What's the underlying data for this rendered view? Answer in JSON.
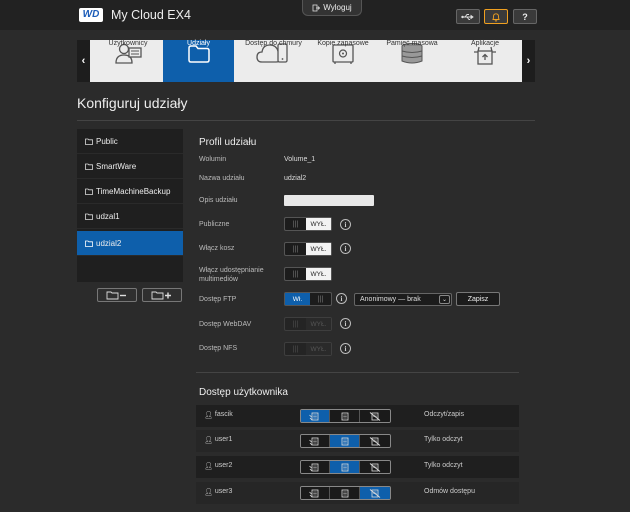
{
  "header": {
    "logo_text": "WD",
    "product": "My Cloud EX4",
    "logout_label": "Wyloguj",
    "help_label": "?"
  },
  "nav": {
    "items": [
      {
        "label": "Użytkownicy",
        "icon": "users-icon"
      },
      {
        "label": "Udziały",
        "icon": "folder-icon",
        "active": true
      },
      {
        "label": "Dostęp do chmury",
        "icon": "cloud-device-icon"
      },
      {
        "label": "Kopie zapasowe",
        "icon": "safe-icon"
      },
      {
        "label": "Pamięć masowa",
        "icon": "storage-stack-icon"
      },
      {
        "label": "Aplikacje",
        "icon": "apps-icon"
      }
    ]
  },
  "page_title": "Konfiguruj udziały",
  "shares": [
    {
      "name": "Public"
    },
    {
      "name": "SmartWare"
    },
    {
      "name": "TimeMachineBackup"
    },
    {
      "name": "udzal1"
    },
    {
      "name": "udzial2",
      "active": true
    }
  ],
  "profile": {
    "title": "Profil udziału",
    "volume_label": "Wolumin",
    "volume_value": "Volume_1",
    "share_name_label": "Nazwa udziału",
    "share_name_value": "udzial2",
    "desc_label": "Opis udziału",
    "desc_value": "",
    "public_label": "Publiczne",
    "public_state": "WYŁ.",
    "recycle_label": "Włącz kosz",
    "recycle_state": "WYŁ.",
    "media_label_1": "Włącz udostępnianie",
    "media_label_2": "multimediów",
    "media_state": "WYŁ.",
    "ftp_label": "Dostęp FTP",
    "ftp_state": "Wł.",
    "ftp_select": "Anonimowy — brak",
    "save_label": "Zapisz",
    "webdav_label": "Dostęp WebDAV",
    "webdav_state": "WYŁ.",
    "nfs_label": "Dostęp NFS",
    "nfs_state": "WYŁ."
  },
  "user_access": {
    "title": "Dostęp użytkownika",
    "users": [
      {
        "name": "fascik",
        "permission_index": 0,
        "status": "Odczyt/zapis"
      },
      {
        "name": "user1",
        "permission_index": 1,
        "status": "Tylko odczyt"
      },
      {
        "name": "user2",
        "permission_index": 1,
        "status": "Tylko odczyt"
      },
      {
        "name": "user3",
        "permission_index": 2,
        "status": "Odmów dostępu"
      }
    ]
  },
  "colors": {
    "accent": "#0e5fab",
    "background": "#2b2b2b",
    "alert": "#f0a020"
  }
}
